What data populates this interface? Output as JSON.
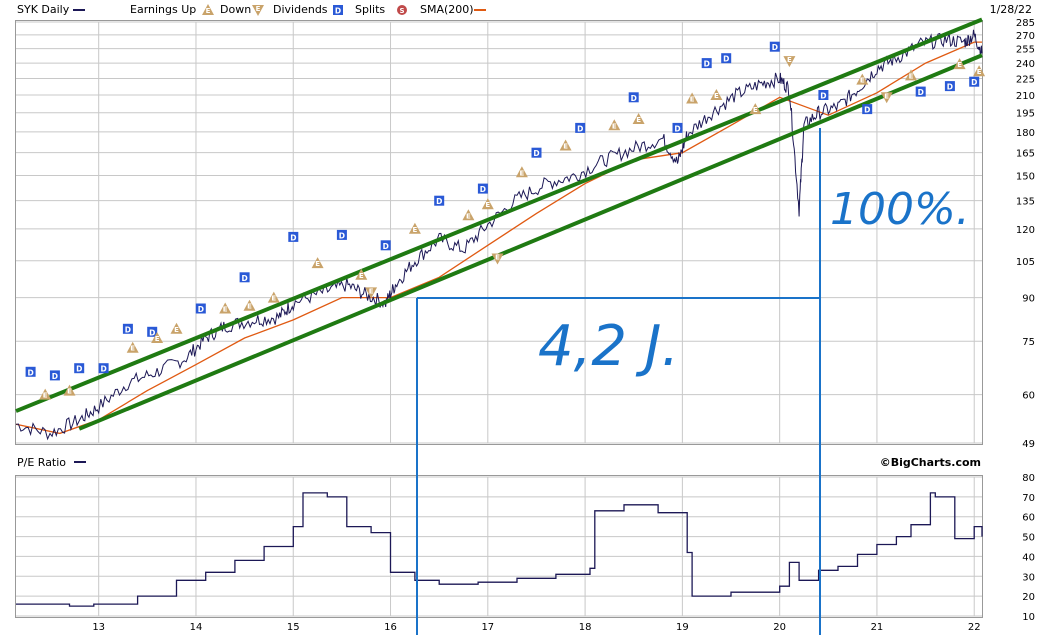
{
  "header": {
    "ticker_label": "SYK Daily",
    "earnings_up_label": "Earnings Up",
    "down_label": "Down",
    "dividends_label": "Dividends",
    "splits_label": "Splits",
    "sma_label": "SMA(200)",
    "date": "1/28/22",
    "dividend_symbol": "D",
    "earnings_symbol": "E",
    "split_symbol": "S"
  },
  "lower_panel": {
    "pe_label": "P/E Ratio",
    "credit": "©BigCharts.com"
  },
  "annotations": {
    "gain_text": "100%.",
    "duration_text": "4,2 J."
  },
  "colors": {
    "price": "#1c1856",
    "sma": "#e05a12",
    "trend_channel": "#1f7a12",
    "annotation": "#1a73c9",
    "dividend_marker": "#2a59d6",
    "earnings_marker": "#c9a36a",
    "split_marker": "#c04a4a",
    "grid": "#c8c8c8"
  },
  "chart_data": [
    {
      "type": "line",
      "panel": "price",
      "title": "SYK Daily",
      "y_scale": "log",
      "ylim": [
        49,
        285
      ],
      "y_ticks": [
        49,
        60,
        75,
        90,
        105,
        120,
        135,
        150,
        165,
        180,
        195,
        210,
        225,
        240,
        255,
        270,
        285
      ],
      "x_ticks": [
        "13",
        "14",
        "15",
        "16",
        "17",
        "18",
        "19",
        "20",
        "21",
        "22"
      ],
      "xlim": [
        2012.15,
        2022.08
      ],
      "grid": true,
      "series": [
        {
          "name": "SYK Daily",
          "x": [
            2012.15,
            2012.5,
            2012.8,
            2013.0,
            2013.3,
            2013.6,
            2013.9,
            2014.1,
            2014.3,
            2014.6,
            2014.85,
            2015.0,
            2015.3,
            2015.55,
            2015.75,
            2015.95,
            2016.05,
            2016.25,
            2016.5,
            2016.75,
            2017.0,
            2017.3,
            2017.6,
            2017.9,
            2018.2,
            2018.5,
            2018.8,
            2018.95,
            2019.05,
            2019.3,
            2019.55,
            2019.8,
            2020.0,
            2020.1,
            2020.2,
            2020.25,
            2020.4,
            2020.6,
            2020.8,
            2021.0,
            2021.2,
            2021.45,
            2021.7,
            2021.9,
            2022.0,
            2022.08
          ],
          "y": [
            53,
            51,
            54,
            57,
            63,
            66,
            70,
            76,
            80,
            82,
            83,
            88,
            92,
            95,
            91,
            88,
            95,
            105,
            115,
            110,
            122,
            136,
            145,
            150,
            160,
            168,
            175,
            158,
            178,
            195,
            210,
            220,
            225,
            215,
            130,
            185,
            195,
            200,
            215,
            235,
            245,
            260,
            265,
            262,
            270,
            250
          ]
        },
        {
          "name": "SMA(200)",
          "x": [
            2012.15,
            2012.6,
            2013.0,
            2013.5,
            2014.0,
            2014.5,
            2015.0,
            2015.5,
            2016.0,
            2016.5,
            2017.0,
            2017.5,
            2018.0,
            2018.5,
            2019.0,
            2019.5,
            2020.0,
            2020.5,
            2021.0,
            2021.5,
            2022.0,
            2022.08
          ],
          "y": [
            53,
            51,
            54,
            61,
            68,
            76,
            82,
            90,
            90,
            98,
            112,
            128,
            145,
            160,
            165,
            185,
            208,
            193,
            212,
            240,
            262,
            262
          ]
        }
      ],
      "channel_lines": [
        {
          "x": [
            2012.15,
            2022.08
          ],
          "y": [
            56,
            288
          ]
        },
        {
          "x": [
            2012.8,
            2022.08
          ],
          "y": [
            52,
            248
          ]
        }
      ],
      "markers": [
        {
          "kind": "D",
          "x": 2012.3,
          "y": 66
        },
        {
          "kind": "D",
          "x": 2012.55,
          "y": 65
        },
        {
          "kind": "D",
          "x": 2012.8,
          "y": 67
        },
        {
          "kind": "D",
          "x": 2013.05,
          "y": 67
        },
        {
          "kind": "D",
          "x": 2013.3,
          "y": 79
        },
        {
          "kind": "D",
          "x": 2013.55,
          "y": 78
        },
        {
          "kind": "D",
          "x": 2014.05,
          "y": 86
        },
        {
          "kind": "D",
          "x": 2014.5,
          "y": 98
        },
        {
          "kind": "D",
          "x": 2015.0,
          "y": 116
        },
        {
          "kind": "D",
          "x": 2015.5,
          "y": 117
        },
        {
          "kind": "D",
          "x": 2015.95,
          "y": 112
        },
        {
          "kind": "D",
          "x": 2016.5,
          "y": 135
        },
        {
          "kind": "D",
          "x": 2016.95,
          "y": 142
        },
        {
          "kind": "D",
          "x": 2017.5,
          "y": 165
        },
        {
          "kind": "D",
          "x": 2017.95,
          "y": 183
        },
        {
          "kind": "D",
          "x": 2018.5,
          "y": 208
        },
        {
          "kind": "D",
          "x": 2018.95,
          "y": 183
        },
        {
          "kind": "D",
          "x": 2019.25,
          "y": 240
        },
        {
          "kind": "D",
          "x": 2019.45,
          "y": 245
        },
        {
          "kind": "D",
          "x": 2019.95,
          "y": 257
        },
        {
          "kind": "D",
          "x": 2020.45,
          "y": 210
        },
        {
          "kind": "D",
          "x": 2020.9,
          "y": 198
        },
        {
          "kind": "D",
          "x": 2021.45,
          "y": 213
        },
        {
          "kind": "D",
          "x": 2021.75,
          "y": 218
        },
        {
          "kind": "D",
          "x": 2022.0,
          "y": 222
        },
        {
          "kind": "E",
          "x": 2012.45,
          "y": 60
        },
        {
          "kind": "E",
          "x": 2012.7,
          "y": 61
        },
        {
          "kind": "E",
          "x": 2013.35,
          "y": 73
        },
        {
          "kind": "E",
          "x": 2013.6,
          "y": 76
        },
        {
          "kind": "E",
          "x": 2013.8,
          "y": 79
        },
        {
          "kind": "E",
          "x": 2014.3,
          "y": 86
        },
        {
          "kind": "E",
          "x": 2014.55,
          "y": 87
        },
        {
          "kind": "E",
          "x": 2014.8,
          "y": 90
        },
        {
          "kind": "E",
          "x": 2015.25,
          "y": 104
        },
        {
          "kind": "E",
          "x": 2015.7,
          "y": 99
        },
        {
          "kind": "E",
          "x": 2016.25,
          "y": 120
        },
        {
          "kind": "E",
          "x": 2016.8,
          "y": 127
        },
        {
          "kind": "E",
          "x": 2017.0,
          "y": 133
        },
        {
          "kind": "E",
          "x": 2017.35,
          "y": 152
        },
        {
          "kind": "E",
          "x": 2017.8,
          "y": 170
        },
        {
          "kind": "E",
          "x": 2018.3,
          "y": 185
        },
        {
          "kind": "E",
          "x": 2018.55,
          "y": 190
        },
        {
          "kind": "E",
          "x": 2019.1,
          "y": 207
        },
        {
          "kind": "E",
          "x": 2019.35,
          "y": 210
        },
        {
          "kind": "E",
          "x": 2019.75,
          "y": 198
        },
        {
          "kind": "E",
          "x": 2020.85,
          "y": 224
        },
        {
          "kind": "E",
          "x": 2021.35,
          "y": 228
        },
        {
          "kind": "E",
          "x": 2021.85,
          "y": 239
        },
        {
          "kind": "E",
          "x": 2022.05,
          "y": 232
        },
        {
          "kind": "down",
          "x": 2015.8,
          "y": 92
        },
        {
          "kind": "down",
          "x": 2017.1,
          "y": 106
        },
        {
          "kind": "down",
          "x": 2020.1,
          "y": 242
        },
        {
          "kind": "down",
          "x": 2021.1,
          "y": 208
        }
      ]
    },
    {
      "type": "line",
      "panel": "pe_ratio",
      "title": "P/E Ratio",
      "ylim": [
        10,
        80
      ],
      "y_ticks": [
        10,
        20,
        30,
        40,
        50,
        60,
        70,
        80
      ],
      "x_ticks": [
        "13",
        "14",
        "15",
        "16",
        "17",
        "18",
        "19",
        "20",
        "21",
        "22"
      ],
      "xlim": [
        2012.15,
        2022.08
      ],
      "grid": true,
      "series": [
        {
          "name": "P/E Ratio",
          "x": [
            2012.15,
            2012.7,
            2012.95,
            2013.4,
            2013.8,
            2014.1,
            2014.4,
            2014.7,
            2015.0,
            2015.1,
            2015.35,
            2015.55,
            2015.8,
            2016.0,
            2016.25,
            2016.5,
            2016.9,
            2017.3,
            2017.7,
            2018.05,
            2018.1,
            2018.4,
            2018.75,
            2019.05,
            2019.1,
            2019.5,
            2020.0,
            2020.1,
            2020.2,
            2020.4,
            2020.6,
            2020.8,
            2021.0,
            2021.2,
            2021.35,
            2021.55,
            2021.6,
            2021.8,
            2022.0,
            2022.08
          ],
          "y": [
            16,
            15,
            16,
            20,
            28,
            32,
            38,
            45,
            55,
            72,
            70,
            55,
            52,
            32,
            28,
            26,
            27,
            29,
            31,
            34,
            63,
            66,
            62,
            42,
            20,
            22,
            25,
            37,
            28,
            33,
            35,
            41,
            46,
            50,
            56,
            72,
            70,
            49,
            55,
            50
          ]
        }
      ]
    }
  ]
}
